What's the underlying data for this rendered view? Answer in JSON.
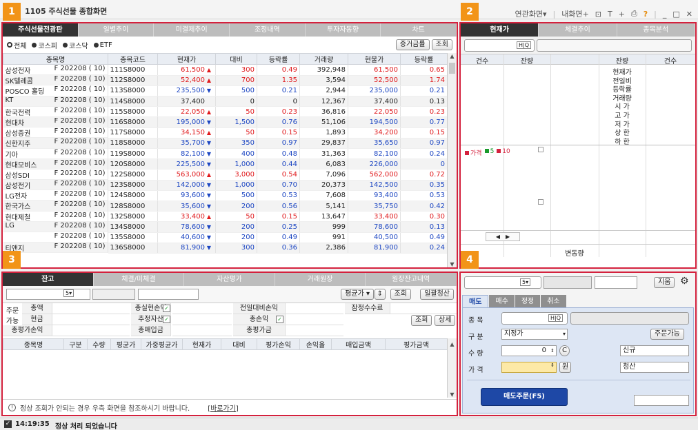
{
  "app": {
    "title": "1105 주식선물 종합화면",
    "menu_linked": "연관화면",
    "menu_my": "내화면"
  },
  "badges": [
    "1",
    "2",
    "3",
    "4"
  ],
  "p1": {
    "tabs": [
      "주식선물전광판",
      "일별추이",
      "미결제추이",
      "조정내역",
      "투자자동향",
      "차트"
    ],
    "filters": [
      "전체",
      "코스피",
      "코스닥",
      "ETF"
    ],
    "btn_margin": "증거금률",
    "btn_query": "조회",
    "headers": [
      "종목명",
      "종목코드",
      "현재가",
      "대비",
      "등락률",
      "거래량",
      "현물가",
      "등락률"
    ],
    "rows": [
      [
        "삼성전자",
        "F 202208 ( 10)",
        "111S8000",
        "61,500",
        "u",
        "300",
        "0.49",
        "392,948",
        "61,500",
        "0.65"
      ],
      [
        "SK텔레콤",
        "F 202208 ( 10)",
        "112S8000",
        "52,400",
        "u",
        "700",
        "1.35",
        "3,594",
        "52,500",
        "1.74"
      ],
      [
        "POSCO 홀딩",
        "F 202208 ( 10)",
        "113S8000",
        "235,500",
        "d",
        "500",
        "0.21",
        "2,944",
        "235,000",
        "0.21"
      ],
      [
        "KT",
        "F 202208 ( 10)",
        "114S8000",
        "37,400",
        "",
        "0",
        "0",
        "12,367",
        "37,400",
        "0.13"
      ],
      [
        "한국전력",
        "F 202208 ( 10)",
        "115S8000",
        "22,050",
        "u",
        "50",
        "0.23",
        "36,816",
        "22,050",
        "0.23"
      ],
      [
        "현대차",
        "F 202208 ( 10)",
        "116S8000",
        "195,000",
        "d",
        "1,500",
        "0.76",
        "51,106",
        "194,500",
        "0.77"
      ],
      [
        "삼성증권",
        "F 202208 ( 10)",
        "117S8000",
        "34,150",
        "u",
        "50",
        "0.15",
        "1,893",
        "34,200",
        "0.15"
      ],
      [
        "신한지주",
        "F 202208 ( 10)",
        "118S8000",
        "35,700",
        "d",
        "350",
        "0.97",
        "29,837",
        "35,650",
        "0.97"
      ],
      [
        "기아",
        "F 202208 ( 10)",
        "119S8000",
        "82,100",
        "d",
        "400",
        "0.48",
        "31,363",
        "82,100",
        "0.24"
      ],
      [
        "현대모비스",
        "F 202208 ( 10)",
        "120S8000",
        "225,500",
        "d",
        "1,000",
        "0.44",
        "6,083",
        "226,000",
        "0"
      ],
      [
        "삼성SDI",
        "F 202208 ( 10)",
        "122S8000",
        "563,000",
        "u",
        "3,000",
        "0.54",
        "7,096",
        "562,000",
        "0.72"
      ],
      [
        "삼성전기",
        "F 202208 ( 10)",
        "123S8000",
        "142,000",
        "d",
        "1,000",
        "0.70",
        "20,373",
        "142,500",
        "0.35"
      ],
      [
        "LG전자",
        "F 202208 ( 10)",
        "124S8000",
        "93,600",
        "d",
        "500",
        "0.53",
        "7,608",
        "93,400",
        "0.53"
      ],
      [
        "한국가스",
        "F 202208 ( 10)",
        "128S8000",
        "35,600",
        "d",
        "200",
        "0.56",
        "5,141",
        "35,750",
        "0.42"
      ],
      [
        "현대제철",
        "F 202208 ( 10)",
        "132S8000",
        "33,400",
        "u",
        "50",
        "0.15",
        "13,647",
        "33,400",
        "0.30"
      ],
      [
        "LG",
        "F 202208 ( 10)",
        "134S8000",
        "78,600",
        "d",
        "200",
        "0.25",
        "999",
        "78,600",
        "0.13"
      ],
      [
        "",
        "F 202208 ( 10)",
        "135S8000",
        "40,600",
        "d",
        "200",
        "0.49",
        "991",
        "40,500",
        "0.49"
      ],
      [
        "티앤지",
        "F 202208 ( 10)",
        "136S8000",
        "81,900",
        "d",
        "300",
        "0.36",
        "2,386",
        "81,900",
        "0.24"
      ]
    ]
  },
  "p2": {
    "tabs": [
      "현재가",
      "체결추이",
      "종목분석"
    ],
    "headers": [
      "건수",
      "잔량",
      "",
      "잔량",
      "건수"
    ],
    "info": [
      "현재가",
      "전일비",
      "등락률",
      "거래량",
      "시 가",
      "고 가",
      "저 가",
      "상 한",
      "하 한"
    ],
    "legend": [
      "가격",
      "5",
      "10"
    ],
    "footer": "변동량"
  },
  "p3": {
    "tabs": [
      "잔고",
      "체결/미체결",
      "자산평가",
      "거래원장",
      "원장잔고내역"
    ],
    "avg": "평균가",
    "btn_query": "조회",
    "btn_settle": "일괄청산",
    "l_order1": "주문",
    "l_order2": "가능",
    "l_total": "총액",
    "l_cash": "현금",
    "l_realized": "총실현손익",
    "l_est": "추정자산",
    "l_prevday": "전일대비손익",
    "l_fee": "잠정수수료",
    "l_totalpl": "총손익",
    "l_evalpl": "총평가손익",
    "l_buy": "총매입금",
    "l_eval": "총평가금",
    "btn_query2": "조회",
    "btn_detail": "상세",
    "headers": [
      "종목명",
      "구분",
      "수량",
      "평균가",
      "가중평균가",
      "현재가",
      "대비",
      "평가손익",
      "손익율",
      "매입금액",
      "평가금액"
    ],
    "notice": "정상 조회가 안되는 경우 우측 화면을 참조하시기 바랍니다.",
    "link": "[바로가기]"
  },
  "p4": {
    "btn_clear": "지움",
    "tabs": [
      "매도",
      "매수",
      "정정",
      "취소"
    ],
    "l_item": "종 목",
    "l_type": "구 분",
    "type_value": "지정가",
    "btn_avail": "주문가능",
    "l_qty": "수 량",
    "qty_value": "0",
    "btn_c": "C",
    "l_new": "신규",
    "l_price": "가 격",
    "unit_won": "원",
    "l_close": "청산",
    "btn_sell": "매도주문(F5)"
  },
  "status": {
    "time": "14:19:35",
    "message": "정상 처리 되었습니다"
  }
}
